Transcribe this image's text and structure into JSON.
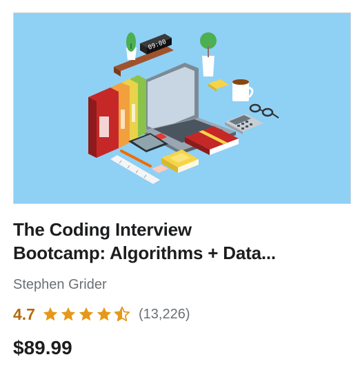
{
  "course": {
    "thumbnail_icon": "workspace-illustration-icon",
    "clock_text": "09:00",
    "title_line1": "The Coding Interview",
    "title_line2": "Bootcamp: Algorithms + Data...",
    "author": "Stephen Grider",
    "rating": "4.7",
    "rating_fraction": 0.94,
    "rating_count": "(13,226)",
    "price": "$89.99"
  },
  "colors": {
    "rating": "#b4690e",
    "star": "#e59819",
    "thumb_bg": "#8fd0f5",
    "muted_text": "#6a6f73"
  }
}
